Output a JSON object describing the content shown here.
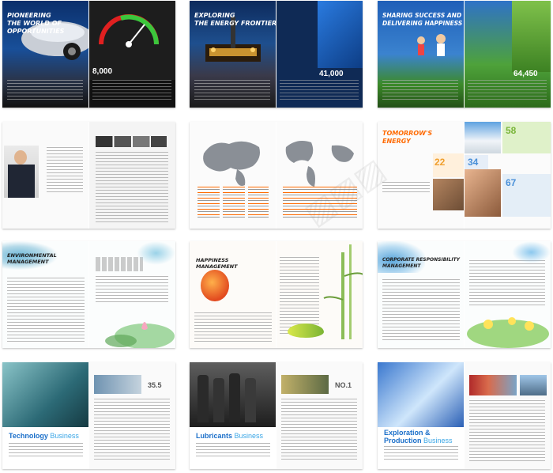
{
  "spreads": {
    "s1": {
      "title_line1": "PIONEERING",
      "title_line2": "THE WORLD OF",
      "title_line3": "OPPORTUNITIES",
      "stat": "8,000"
    },
    "s2": {
      "title_line1": "EXPLORING",
      "title_line2": "THE ENERGY FRONTIERS",
      "stat": "41,000"
    },
    "s3": {
      "title_line1": "SHARING SUCCESS AND",
      "title_line2": "DELIVERING HAPPINESS",
      "stat": "64,450"
    },
    "s6": {
      "title_line1": "TOMORROW'S",
      "title_line2": "ENERGY",
      "numbers": [
        "22",
        "58",
        "34",
        "67"
      ]
    },
    "s7": {
      "title_line1": "ENVIRONMENTAL",
      "title_line2": "MANAGEMENT"
    },
    "s8": {
      "title_line1": "HAPPINESS",
      "title_line2": "MANAGEMENT"
    },
    "s9": {
      "title_line1": "CORPORATE RESPONSIBILITY",
      "title_line2": "MANAGEMENT"
    },
    "s10": {
      "title_part1": "Technology",
      "title_part2": "Business",
      "stat": "35.5"
    },
    "s11": {
      "title_part1": "Lubricants",
      "title_part2": "Business",
      "stat": "NO.1"
    },
    "s12": {
      "title_line1": "Exploration &",
      "title_line2_part1": "Production",
      "title_line2_part2": "Business"
    }
  },
  "colors": {
    "accent_orange": "#ff6a00",
    "blue": "#1b6fc9",
    "light_blue": "#3aa6e6"
  }
}
